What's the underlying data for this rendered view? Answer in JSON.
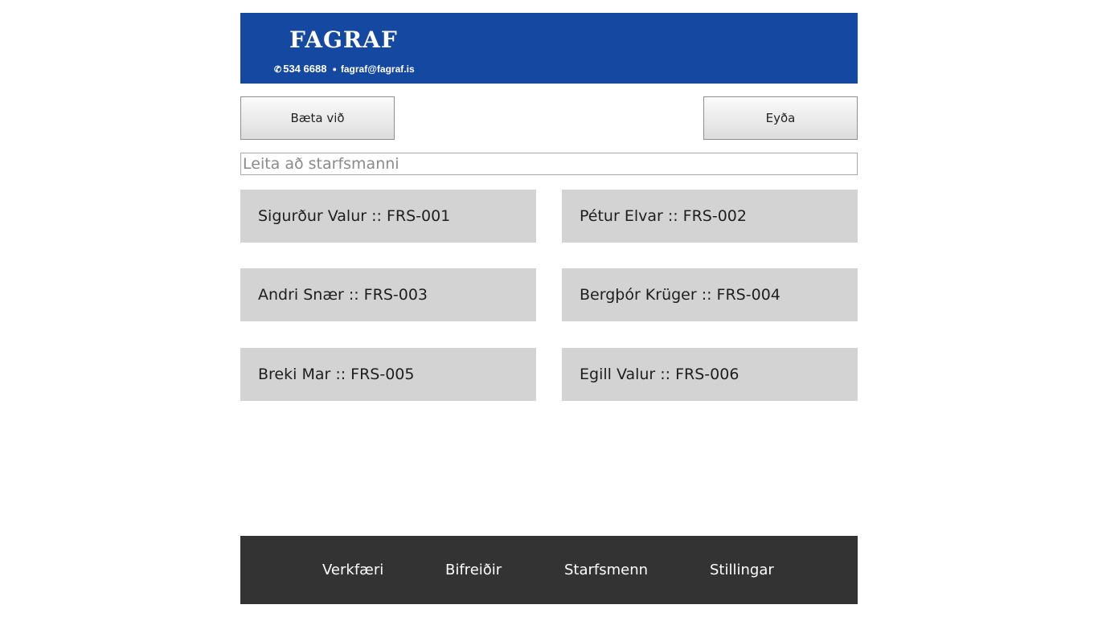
{
  "header": {
    "logo_title": "FAGRAF",
    "phone": "534 6688",
    "email": "fagraf@fagraf.is",
    "background_color": "#1548a0"
  },
  "toolbar": {
    "add_label": "Bæta við",
    "delete_label": "Eyða"
  },
  "search": {
    "placeholder": "Leita að starfsmanni",
    "value": ""
  },
  "employees": [
    {
      "label": "Sigurður Valur :: FRS-001"
    },
    {
      "label": "Pétur Elvar :: FRS-002"
    },
    {
      "label": "Andri Snær :: FRS-003"
    },
    {
      "label": "Bergþór Krüger :: FRS-004"
    },
    {
      "label": "Breki Mar :: FRS-005"
    },
    {
      "label": "Egill Valur :: FRS-006"
    }
  ],
  "footer_nav": {
    "items": [
      {
        "label": "Verkfæri"
      },
      {
        "label": "Bifreiðir"
      },
      {
        "label": "Starfsmenn"
      },
      {
        "label": "Stillingar"
      }
    ],
    "background_color": "#333333"
  }
}
